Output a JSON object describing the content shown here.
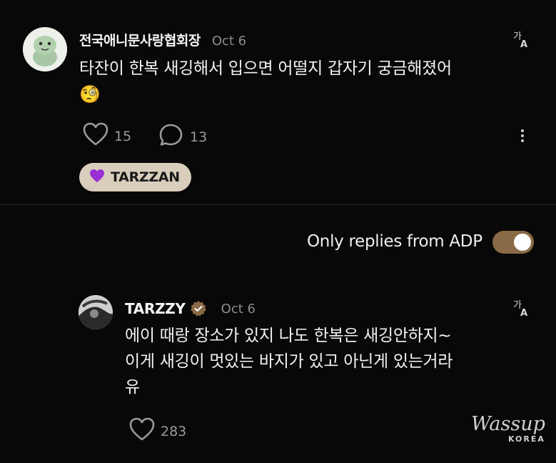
{
  "post": {
    "username": "전국애니문사랑협회장",
    "date": "Oct 6",
    "text": "타잔이 한복 새깅해서 입으면 어떨지 갑자기 궁금해졌어",
    "emoji": "🧐",
    "likes": "15",
    "comments": "13",
    "tag_label": "TARZZAN",
    "tag_color": "#9b2fd6"
  },
  "filter": {
    "label": "Only replies from ADP",
    "enabled": true,
    "toggle_color": "#8a6a46"
  },
  "reply": {
    "username": "TARZZY",
    "date": "Oct 6",
    "text_line1": "에이 때랑 장소가 있지 나도 한복은 새깅안하지~",
    "text_line2": "이게 새깅이 멋있는 바지가 있고 아닌게 있는거라",
    "text_line3": "유",
    "likes": "283"
  },
  "watermark": {
    "brand": "Wassup",
    "sub": "KOREA"
  }
}
